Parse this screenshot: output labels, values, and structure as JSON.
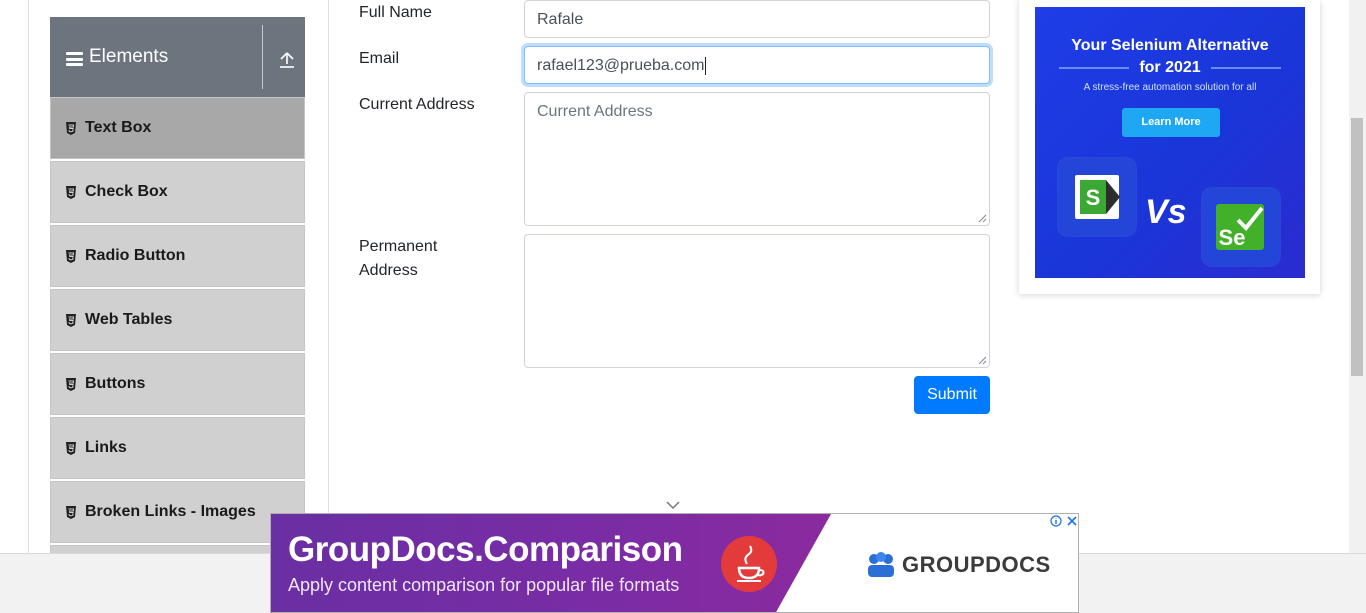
{
  "sidebar": {
    "group_title": "Elements",
    "items": [
      {
        "label": "Text Box",
        "active": true
      },
      {
        "label": "Check Box",
        "active": false
      },
      {
        "label": "Radio Button",
        "active": false
      },
      {
        "label": "Web Tables",
        "active": false
      },
      {
        "label": "Buttons",
        "active": false
      },
      {
        "label": "Links",
        "active": false
      },
      {
        "label": "Broken Links - Images",
        "active": false
      }
    ]
  },
  "form": {
    "full_name_label": "Full Name",
    "full_name_value": "Rafale",
    "email_label": "Email",
    "email_value": "rafael123@prueba.com",
    "current_address_label": "Current Address",
    "current_address_placeholder": "Current Address",
    "permanent_address_label_line1": "Permanent",
    "permanent_address_label_line2": "Address",
    "submit_label": "Submit"
  },
  "side_ad": {
    "headline_line1": "Your Selenium Alternative",
    "headline_line2": "for 2021",
    "subtitle": "A stress-free automation solution for all",
    "cta": "Learn More",
    "vs_text": "Vs",
    "logo_left": "S",
    "logo_right": "Se"
  },
  "bottom_ad": {
    "title": "GroupDocs.Comparison",
    "subtitle": "Apply content comparison for popular file formats",
    "brand": "GROUPDOCS"
  },
  "colors": {
    "primary": "#007bff",
    "sidebar_header": "#6c757d",
    "menu_item": "#d0d0d0",
    "menu_item_active": "#a8a8a8"
  }
}
